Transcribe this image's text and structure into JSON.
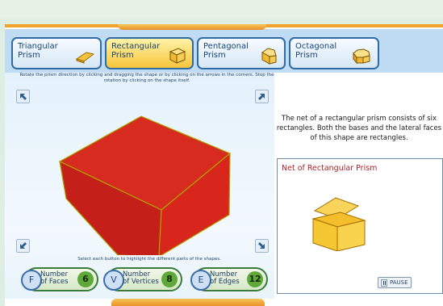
{
  "tabs": [
    {
      "label": "Triangular\nPrism",
      "icon": "triangular-prism-icon",
      "active": false
    },
    {
      "label": "Rectangular\nPrism",
      "icon": "rectangular-prism-icon",
      "active": true
    },
    {
      "label": "Pentagonal\nPrism",
      "icon": "pentagonal-prism-icon",
      "active": false
    },
    {
      "label": "Octagonal\nPrism",
      "icon": "octagonal-prism-icon",
      "active": false
    }
  ],
  "instructions": "Rotate the prism direction by clicking and dragging the shape or by clicking on the arrows in the corners. Stop the rotation by clicking on the shape itself.",
  "select_note": "Select each button to highlight the different parts of the shapes.",
  "counters": [
    {
      "letter": "F",
      "label": "Number\nof Faces",
      "count": "6"
    },
    {
      "letter": "V",
      "label": "Number\nof Vertices",
      "count": "8"
    },
    {
      "letter": "E",
      "label": "Number\nof Edges",
      "count": "12"
    }
  ],
  "description": "The net of a rectangular prism consists of six rectangles. Both the bases and the lateral faces of this shape are rectangles.",
  "net": {
    "title": "Net of Rectangular Prism"
  },
  "pause_label": "PAUSE",
  "colors": {
    "accent": "#f2a12a",
    "prism_red": "#d9231d",
    "net_yellow": "#f7c531",
    "tab_border": "#2f6ca6"
  }
}
